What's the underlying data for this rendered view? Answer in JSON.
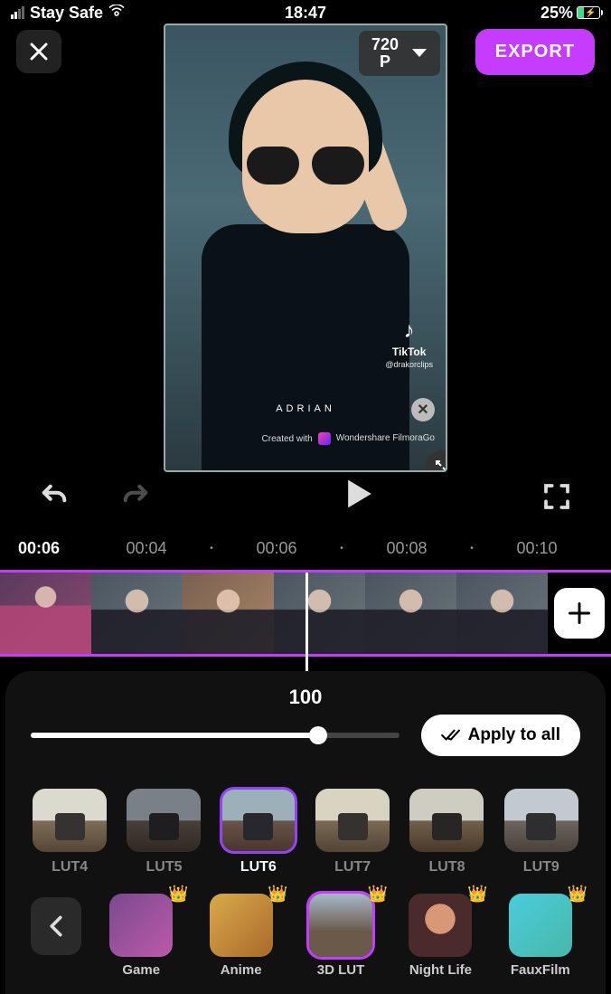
{
  "status": {
    "carrier": "Stay Safe",
    "time": "18:47",
    "battery_pct": "25%"
  },
  "header": {
    "resolution_line1": "720",
    "resolution_line2": "P",
    "export_label": "EXPORT"
  },
  "preview": {
    "tiktok_label": "TikTok",
    "tiktok_user": "@drakorclips",
    "watermark_name": "ADRIAN",
    "madewith_prefix": "Created with",
    "madewith_brand": "Wondershare FilmoraGo"
  },
  "ruler": {
    "current": "00:06",
    "t1": "00:04",
    "t2": "00:06",
    "t3": "00:08",
    "t4": "00:10"
  },
  "panel": {
    "intensity": "100",
    "apply_all": "Apply to all"
  },
  "luts": [
    {
      "label": "LUT4"
    },
    {
      "label": "LUT5"
    },
    {
      "label": "LUT6"
    },
    {
      "label": "LUT7"
    },
    {
      "label": "LUT8"
    },
    {
      "label": "LUT9"
    }
  ],
  "categories": [
    {
      "label": "Game"
    },
    {
      "label": "Anime"
    },
    {
      "label": "3D LUT"
    },
    {
      "label": "Night Life"
    },
    {
      "label": "FauxFilm"
    }
  ]
}
